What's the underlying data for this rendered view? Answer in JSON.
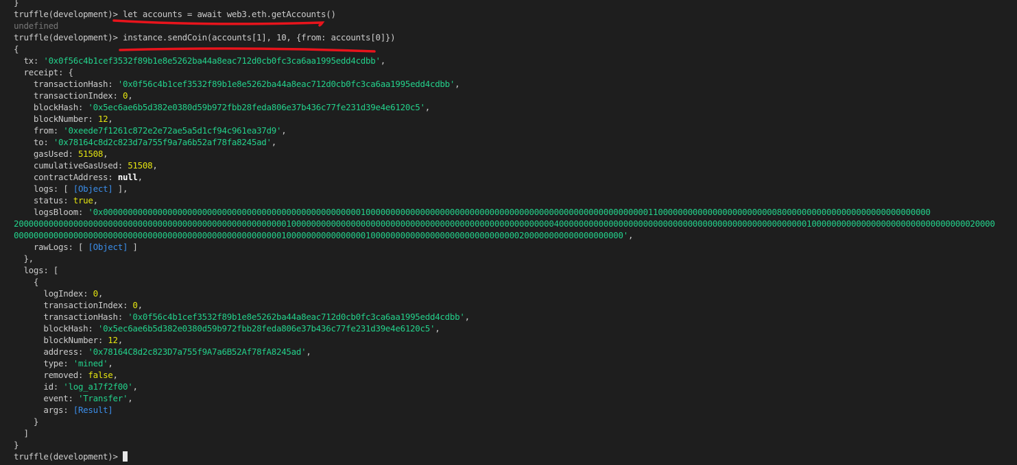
{
  "terminal": {
    "lines": [
      {
        "segments": [
          {
            "text": "}"
          }
        ]
      },
      {
        "segments": [
          {
            "text": "truffle(development)> "
          },
          {
            "text": "let accounts = await web3.eth.getAccounts()"
          }
        ]
      },
      {
        "segments": [
          {
            "text": "undefined",
            "cls": "t-dim"
          }
        ]
      },
      {
        "segments": [
          {
            "text": "truffle(development)> "
          },
          {
            "text": "instance.sendCoin(accounts[1], 10, {from: accounts[0]})"
          }
        ]
      },
      {
        "segments": [
          {
            "text": "{"
          }
        ]
      },
      {
        "segments": [
          {
            "text": "  tx: "
          },
          {
            "text": "'0x0f56c4b1cef3532f89b1e8e5262ba44a8eac712d0cb0fc3ca6aa1995edd4cdbb'",
            "cls": "t-str"
          },
          {
            "text": ","
          }
        ]
      },
      {
        "segments": [
          {
            "text": "  receipt: {"
          }
        ]
      },
      {
        "segments": [
          {
            "text": "    transactionHash: "
          },
          {
            "text": "'0x0f56c4b1cef3532f89b1e8e5262ba44a8eac712d0cb0fc3ca6aa1995edd4cdbb'",
            "cls": "t-str"
          },
          {
            "text": ","
          }
        ]
      },
      {
        "segments": [
          {
            "text": "    transactionIndex: "
          },
          {
            "text": "0",
            "cls": "t-num"
          },
          {
            "text": ","
          }
        ]
      },
      {
        "segments": [
          {
            "text": "    blockHash: "
          },
          {
            "text": "'0x5ec6ae6b5d382e0380d59b972fbb28feda806e37b436c77fe231d39e4e6120c5'",
            "cls": "t-str"
          },
          {
            "text": ","
          }
        ]
      },
      {
        "segments": [
          {
            "text": "    blockNumber: "
          },
          {
            "text": "12",
            "cls": "t-num"
          },
          {
            "text": ","
          }
        ]
      },
      {
        "segments": [
          {
            "text": "    from: "
          },
          {
            "text": "'0xeede7f1261c872e2e72ae5a5d1cf94c961ea37d9'",
            "cls": "t-str"
          },
          {
            "text": ","
          }
        ]
      },
      {
        "segments": [
          {
            "text": "    to: "
          },
          {
            "text": "'0x78164c8d2c823d7a755f9a7a6b52af78fa8245ad'",
            "cls": "t-str"
          },
          {
            "text": ","
          }
        ]
      },
      {
        "segments": [
          {
            "text": "    gasUsed: "
          },
          {
            "text": "51508",
            "cls": "t-num"
          },
          {
            "text": ","
          }
        ]
      },
      {
        "segments": [
          {
            "text": "    cumulativeGasUsed: "
          },
          {
            "text": "51508",
            "cls": "t-num"
          },
          {
            "text": ","
          }
        ]
      },
      {
        "segments": [
          {
            "text": "    contractAddress: "
          },
          {
            "text": "null",
            "cls": "t-kw"
          },
          {
            "text": ","
          }
        ]
      },
      {
        "segments": [
          {
            "text": "    logs: [ "
          },
          {
            "text": "[Object]",
            "cls": "t-ref"
          },
          {
            "text": " ],"
          }
        ]
      },
      {
        "segments": [
          {
            "text": "    status: "
          },
          {
            "text": "true",
            "cls": "t-bool"
          },
          {
            "text": ","
          }
        ]
      },
      {
        "segments": [
          {
            "text": "    logsBloom: "
          },
          {
            "text": "'0x00000000000000000000000000000000000000000000000000001000000000000000000000000000000000000000000000000000000000110000000000000000000000008000000000000000000000000000000",
            "cls": "t-str"
          }
        ]
      },
      {
        "segments": [
          {
            "text": "200000000000000000000000000000000000000000000000000000010000000000000000000000000000000000000000000000000000040000000000000000000000000000000000000000000000000010000000000000000000000000000000020000",
            "cls": "t-str"
          }
        ]
      },
      {
        "segments": [
          {
            "text": "000000000000000000000000000000000000000000000000000000100000000000000001000000000000000000000000000000200000000000000000000'",
            "cls": "t-str"
          },
          {
            "text": ","
          }
        ]
      },
      {
        "segments": [
          {
            "text": "    rawLogs: [ "
          },
          {
            "text": "[Object]",
            "cls": "t-ref"
          },
          {
            "text": " ]"
          }
        ]
      },
      {
        "segments": [
          {
            "text": "  },"
          }
        ]
      },
      {
        "segments": [
          {
            "text": "  logs: ["
          }
        ]
      },
      {
        "segments": [
          {
            "text": "    {"
          }
        ]
      },
      {
        "segments": [
          {
            "text": "      logIndex: "
          },
          {
            "text": "0",
            "cls": "t-num"
          },
          {
            "text": ","
          }
        ]
      },
      {
        "segments": [
          {
            "text": "      transactionIndex: "
          },
          {
            "text": "0",
            "cls": "t-num"
          },
          {
            "text": ","
          }
        ]
      },
      {
        "segments": [
          {
            "text": "      transactionHash: "
          },
          {
            "text": "'0x0f56c4b1cef3532f89b1e8e5262ba44a8eac712d0cb0fc3ca6aa1995edd4cdbb'",
            "cls": "t-str"
          },
          {
            "text": ","
          }
        ]
      },
      {
        "segments": [
          {
            "text": "      blockHash: "
          },
          {
            "text": "'0x5ec6ae6b5d382e0380d59b972fbb28feda806e37b436c77fe231d39e4e6120c5'",
            "cls": "t-str"
          },
          {
            "text": ","
          }
        ]
      },
      {
        "segments": [
          {
            "text": "      blockNumber: "
          },
          {
            "text": "12",
            "cls": "t-num"
          },
          {
            "text": ","
          }
        ]
      },
      {
        "segments": [
          {
            "text": "      address: "
          },
          {
            "text": "'0x78164C8d2c823D7a755f9A7a6B52Af78fA8245ad'",
            "cls": "t-str"
          },
          {
            "text": ","
          }
        ]
      },
      {
        "segments": [
          {
            "text": "      type: "
          },
          {
            "text": "'mined'",
            "cls": "t-str"
          },
          {
            "text": ","
          }
        ]
      },
      {
        "segments": [
          {
            "text": "      removed: "
          },
          {
            "text": "false",
            "cls": "t-bool"
          },
          {
            "text": ","
          }
        ]
      },
      {
        "segments": [
          {
            "text": "      id: "
          },
          {
            "text": "'log_a17f2f00'",
            "cls": "t-str"
          },
          {
            "text": ","
          }
        ]
      },
      {
        "segments": [
          {
            "text": "      event: "
          },
          {
            "text": "'Transfer'",
            "cls": "t-str"
          },
          {
            "text": ","
          }
        ]
      },
      {
        "segments": [
          {
            "text": "      args: "
          },
          {
            "text": "[Result]",
            "cls": "t-ref"
          }
        ]
      },
      {
        "segments": [
          {
            "text": "    }"
          }
        ]
      },
      {
        "segments": [
          {
            "text": "  ]"
          }
        ]
      },
      {
        "segments": [
          {
            "text": "}"
          }
        ]
      },
      {
        "segments": [
          {
            "text": "truffle(development)> "
          }
        ],
        "cursor": true
      }
    ]
  },
  "colors": {
    "background": "#1e1e1e",
    "text": "#cccccc",
    "string": "#23d18b",
    "number": "#e5e510",
    "reference": "#3b8eea",
    "annotation": "#e8141c"
  }
}
